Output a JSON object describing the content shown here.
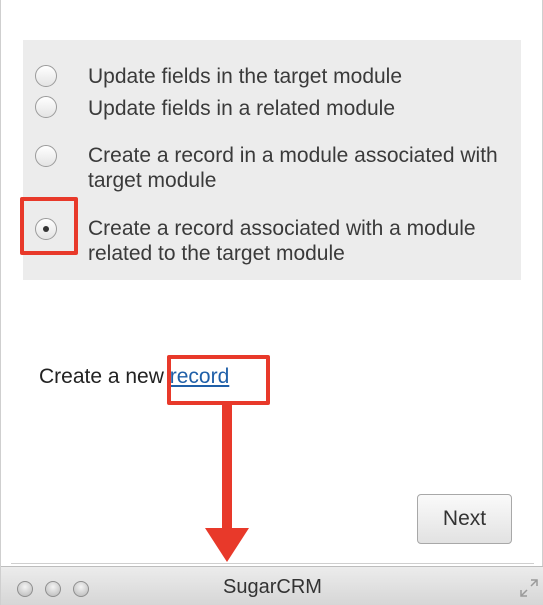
{
  "options": [
    {
      "label": "Update fields in the target module",
      "checked": false
    },
    {
      "label": "Update fields in a related module",
      "checked": false
    },
    {
      "label": "Create a record in a module associated with target module",
      "checked": false
    },
    {
      "label": "Create a record associated with a module related to the target module",
      "checked": true
    }
  ],
  "create": {
    "prefix": "Create a new ",
    "link_label": "record"
  },
  "next_button_label": "Next",
  "window": {
    "title": "SugarCRM"
  },
  "annotation_color": "#e8392a"
}
